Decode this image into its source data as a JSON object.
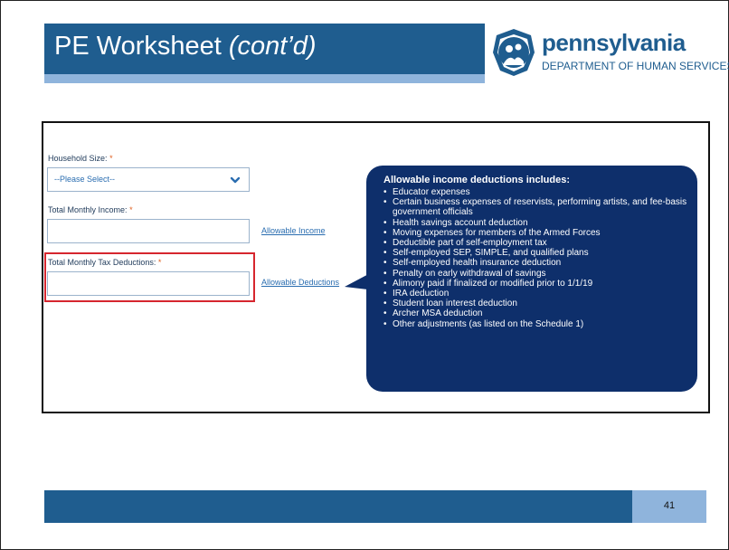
{
  "slide": {
    "title_main": "PE Worksheet ",
    "title_italic": "(cont’d)",
    "page_number": "41"
  },
  "logo": {
    "wordmark": "pennsylvania",
    "subtitle": "DEPARTMENT OF HUMAN SERVICES",
    "icon": "family-seal-icon"
  },
  "form": {
    "household_size": {
      "label": "Household Size:",
      "required_mark": "*",
      "selected_value": "--Please Select--",
      "icon": "chevron-down-icon"
    },
    "total_monthly_income": {
      "label": "Total Monthly Income:",
      "required_mark": "*",
      "value": "",
      "link": "Allowable Income"
    },
    "total_monthly_tax_deductions": {
      "label": "Total Monthly Tax Deductions:",
      "required_mark": "*",
      "value": "",
      "link": "Allowable Deductions"
    }
  },
  "callout": {
    "title": "Allowable income deductions includes:",
    "items": [
      "Educator expenses",
      "Certain business expenses of reservists, performing artists, and fee-basis government officials",
      "Health savings account deduction",
      "Moving expenses for members of the Armed Forces",
      "Deductible part of self-employment tax",
      "Self-employed SEP, SIMPLE, and qualified plans",
      "Self-employed health insurance deduction",
      "Penalty on early withdrawal of savings",
      "Alimony paid if finalized or modified prior to 1/1/19",
      "IRA deduction",
      "Student loan interest deduction",
      "Archer MSA deduction",
      "Other adjustments (as listed on the Schedule 1)"
    ]
  },
  "colors": {
    "brand_blue": "#1f5d8f",
    "light_blue": "#8fb4dc",
    "callout_navy": "#0e2f6b",
    "highlight_red": "#d6262e",
    "required_orange": "#e06020"
  }
}
